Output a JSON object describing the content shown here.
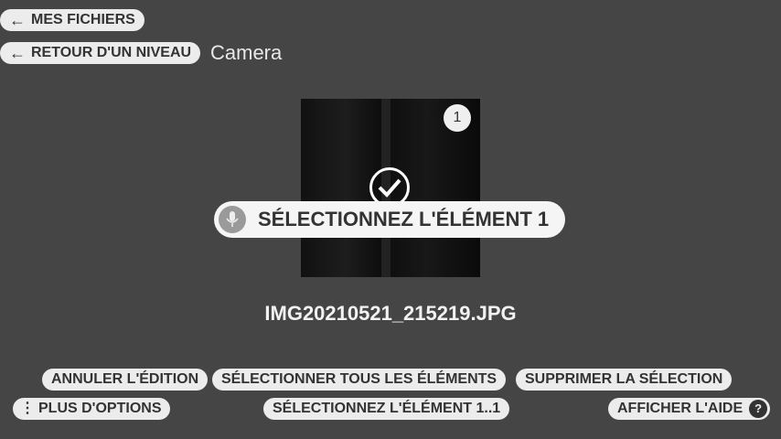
{
  "nav": {
    "my_files": "MES FICHIERS",
    "back_level": "RETOUR D'UN NIVEAU",
    "folder_title": "Camera"
  },
  "item": {
    "badge_number": "1",
    "voice_prompt": "SÉLECTIONNEZ L'ÉLÉMENT 1",
    "filename": "IMG20210521_215219.JPG"
  },
  "actions": {
    "cancel_edit": "ANNULER L'ÉDITION",
    "select_all": "SÉLECTIONNER TOUS LES ÉLÉMENTS",
    "delete_selection": "SUPPRIMER LA SÉLECTION",
    "more_options": "PLUS D'OPTIONS",
    "select_range": "SÉLECTIONNEZ L'ÉLÉMENT 1..1",
    "show_help": "AFFICHER L'AIDE",
    "help_glyph": "?"
  },
  "icons": {
    "back": "arrow-left-icon",
    "selected": "checkmark-circle-icon",
    "voice": "microphone-icon",
    "more": "vertical-dots-icon",
    "help": "question-mark-icon"
  },
  "colors": {
    "background": "#454545",
    "pill": "#ececec",
    "pill_text": "#333333"
  }
}
